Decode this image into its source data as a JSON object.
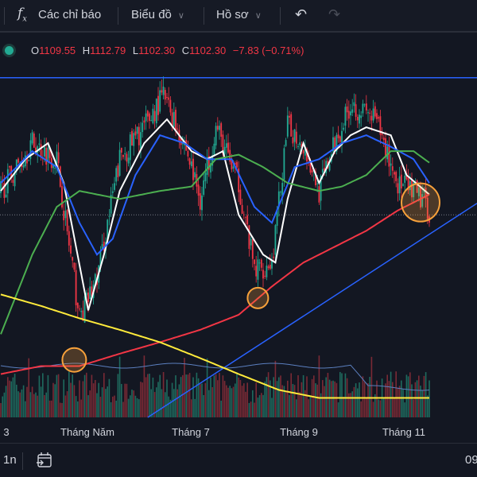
{
  "toolbar": {
    "indicators_label": "Các chỉ báo",
    "chart_label": "Biểu đồ",
    "profile_label": "Hồ sơ"
  },
  "legend": {
    "o_label": "O",
    "o": "1109.55",
    "h_label": "H",
    "h": "1112.79",
    "l_label": "L",
    "l": "1102.30",
    "c_label": "C",
    "c": "1102.30",
    "change": "−7.83 (−0.71%)"
  },
  "time_axis": {
    "labels": [
      "3",
      "Tháng Năm",
      "Tháng 7",
      "Tháng 9",
      "Tháng 11"
    ]
  },
  "bottom": {
    "interval": "1n",
    "time_partial": "09"
  },
  "colors": {
    "up": "#22ab94",
    "down": "#f23645",
    "ma_fast": "#ffffff",
    "ma_mid": "#2962ff",
    "ma_50": "#4caf50",
    "ma_200": "#f23645",
    "ma_long": "#ffeb3b",
    "trend": "#2962ff",
    "highlight": "#f7a13b"
  },
  "chart_data": {
    "type": "candlestick",
    "ylim": [
      880,
      1280
    ],
    "candle_count": 246,
    "close_path": [
      [
        0,
        1136
      ],
      [
        18,
        1190
      ],
      [
        32,
        1172
      ],
      [
        45,
        992
      ],
      [
        55,
        1037
      ],
      [
        68,
        1172
      ],
      [
        82,
        1208
      ],
      [
        93,
        1244
      ],
      [
        105,
        1190
      ],
      [
        114,
        1127
      ],
      [
        123,
        1208
      ],
      [
        136,
        1145
      ],
      [
        145,
        1046
      ],
      [
        155,
        1055
      ],
      [
        164,
        1208
      ],
      [
        173,
        1190
      ],
      [
        182,
        1136
      ],
      [
        191,
        1190
      ],
      [
        200,
        1235
      ],
      [
        214,
        1217
      ],
      [
        227,
        1145
      ],
      [
        241,
        1127
      ],
      [
        245,
        1114
      ]
    ],
    "series": [
      {
        "name": "MA fast",
        "color": "#ffffff",
        "points": [
          [
            0,
            1136
          ],
          [
            14,
            1172
          ],
          [
            27,
            1190
          ],
          [
            36,
            1145
          ],
          [
            50,
            1001
          ],
          [
            59,
            1064
          ],
          [
            68,
            1136
          ],
          [
            82,
            1190
          ],
          [
            95,
            1217
          ],
          [
            109,
            1181
          ],
          [
            118,
            1172
          ],
          [
            127,
            1181
          ],
          [
            136,
            1109
          ],
          [
            150,
            1064
          ],
          [
            157,
            1055
          ],
          [
            164,
            1127
          ],
          [
            173,
            1190
          ],
          [
            182,
            1145
          ],
          [
            191,
            1181
          ],
          [
            200,
            1199
          ],
          [
            209,
            1208
          ],
          [
            223,
            1199
          ],
          [
            232,
            1154
          ],
          [
            245,
            1132
          ]
        ]
      },
      {
        "name": "MA mid",
        "color": "#2962ff",
        "points": [
          [
            0,
            1145
          ],
          [
            18,
            1181
          ],
          [
            32,
            1163
          ],
          [
            45,
            1100
          ],
          [
            55,
            1064
          ],
          [
            64,
            1082
          ],
          [
            77,
            1154
          ],
          [
            91,
            1199
          ],
          [
            105,
            1190
          ],
          [
            118,
            1172
          ],
          [
            132,
            1172
          ],
          [
            145,
            1118
          ],
          [
            155,
            1100
          ],
          [
            168,
            1163
          ],
          [
            182,
            1172
          ],
          [
            195,
            1190
          ],
          [
            209,
            1199
          ],
          [
            223,
            1186
          ],
          [
            236,
            1172
          ],
          [
            245,
            1145
          ]
        ]
      },
      {
        "name": "MA 50",
        "color": "#4caf50",
        "points": [
          [
            0,
            974
          ],
          [
            18,
            1064
          ],
          [
            32,
            1118
          ],
          [
            45,
            1136
          ],
          [
            68,
            1127
          ],
          [
            91,
            1136
          ],
          [
            109,
            1141
          ],
          [
            123,
            1172
          ],
          [
            136,
            1177
          ],
          [
            150,
            1163
          ],
          [
            164,
            1145
          ],
          [
            182,
            1136
          ],
          [
            195,
            1141
          ],
          [
            209,
            1154
          ],
          [
            223,
            1181
          ],
          [
            236,
            1181
          ],
          [
            245,
            1168
          ]
        ]
      },
      {
        "name": "MA 200",
        "color": "#f23645",
        "points": [
          [
            0,
            929
          ],
          [
            23,
            938
          ],
          [
            45,
            938
          ],
          [
            68,
            952
          ],
          [
            91,
            965
          ],
          [
            114,
            979
          ],
          [
            136,
            996
          ],
          [
            155,
            1028
          ],
          [
            173,
            1055
          ],
          [
            191,
            1073
          ],
          [
            209,
            1091
          ],
          [
            227,
            1114
          ],
          [
            245,
            1132
          ]
        ]
      },
      {
        "name": "MA long",
        "color": "#ffeb3b",
        "points": [
          [
            0,
            1019
          ],
          [
            23,
            1006
          ],
          [
            45,
            992
          ],
          [
            68,
            979
          ],
          [
            91,
            965
          ],
          [
            114,
            947
          ],
          [
            136,
            929
          ],
          [
            159,
            911
          ],
          [
            182,
            902
          ],
          [
            205,
            902
          ],
          [
            227,
            902
          ],
          [
            245,
            902
          ]
        ]
      }
    ],
    "horizontal_line": 1264,
    "trend_line": [
      [
        84,
        880
      ],
      [
        273,
        1123
      ]
    ],
    "highlights": [
      [
        42,
        945
      ],
      [
        147,
        1015
      ],
      [
        240,
        1123
      ]
    ],
    "last_price_line": 1109
  }
}
